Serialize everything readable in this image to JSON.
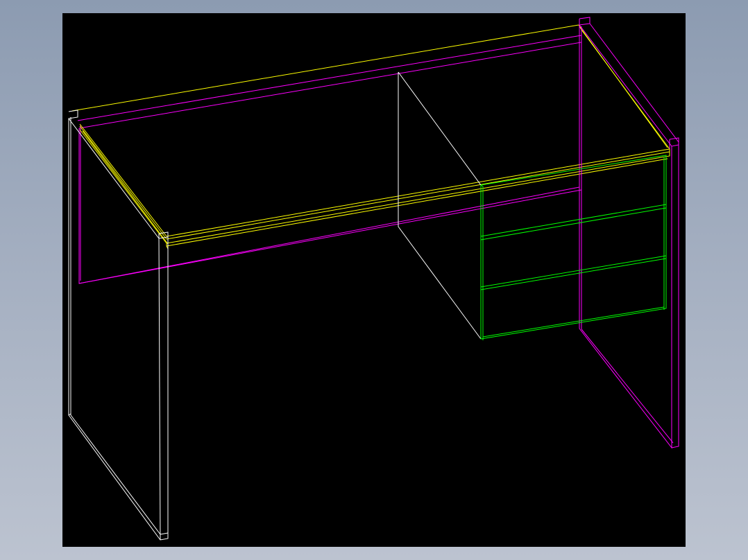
{
  "colors": {
    "background_top": "#8c9bb1",
    "background_bottom": "#bcc3d0",
    "viewport": "#000000",
    "desktop_top": "#ffff00",
    "side_panels_right": "#ff00ff",
    "side_panels_left": "#ffffff",
    "drawers": "#00ff00",
    "partition": "#ffffff"
  },
  "drawing": {
    "subject": "desk-wireframe",
    "drawer_count": 3
  }
}
